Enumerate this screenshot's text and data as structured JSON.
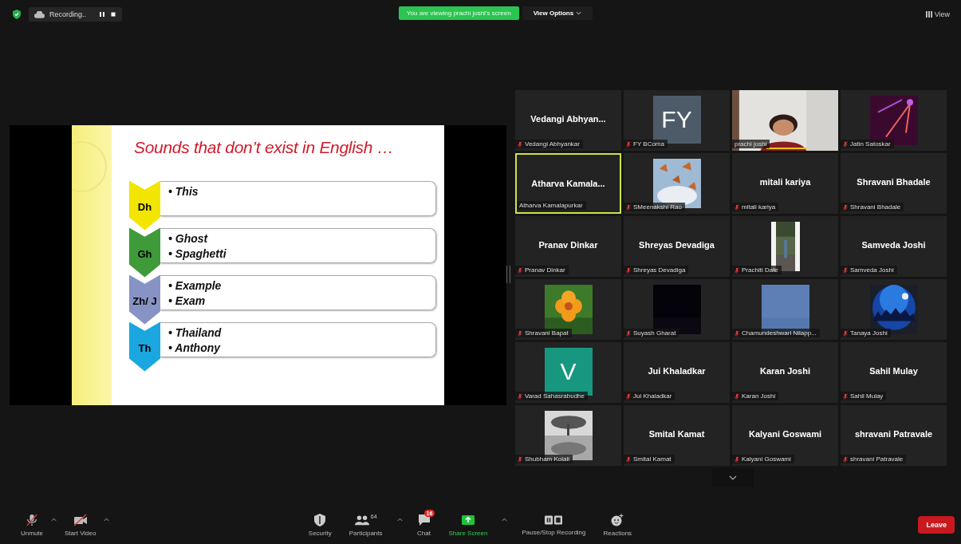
{
  "top_bar": {
    "recording": "Recording..",
    "banner": "You are viewing prachi joshi's screen",
    "view_options": "View Options",
    "view": "View"
  },
  "slide": {
    "title": "Sounds that don’t exist in English …",
    "items": [
      {
        "label": "Dh",
        "color": "#f2e600",
        "bullets": [
          "• This"
        ]
      },
      {
        "label": "Gh",
        "color": "#3f9a3a",
        "bullets": [
          "• Ghost",
          "• Spaghetti"
        ]
      },
      {
        "label": "Zh/ J",
        "color": "#8793c4",
        "bullets": [
          "• Example",
          "• Exam"
        ]
      },
      {
        "label": "Th",
        "color": "#1aa7e0",
        "bullets": [
          "• Thailand",
          "• Anthony"
        ]
      }
    ]
  },
  "tiles": [
    {
      "kind": "name",
      "display": "Vedangi  Abhyan...",
      "name": "Vedangi Abhyankar",
      "muted": true,
      "highlighted": false,
      "talking": false
    },
    {
      "kind": "initials",
      "display": "FY",
      "color": "#4d5b69",
      "name": "FY BComa",
      "muted": true,
      "highlighted": false,
      "talking": false
    },
    {
      "kind": "picture",
      "name": "prachi joshi",
      "muted": false,
      "highlighted": false,
      "talking": true
    },
    {
      "kind": "picture",
      "name": "Jatin Satoskar",
      "muted": true,
      "highlighted": false,
      "talking": false
    },
    {
      "kind": "name",
      "display": "Atharva  Kamala...",
      "name": "Atharva Kamalapurkar",
      "muted": false,
      "highlighted": true,
      "talking": false
    },
    {
      "kind": "picture",
      "name": "SMeenakshi Rao",
      "muted": true,
      "highlighted": false,
      "talking": false
    },
    {
      "kind": "name",
      "display": "mitali kariya",
      "name": "mitali kariya",
      "muted": true,
      "highlighted": false,
      "talking": false
    },
    {
      "kind": "name",
      "display": "Shravani Bhadale",
      "name": "Shravani Bhadale",
      "muted": true,
      "highlighted": false,
      "talking": false
    },
    {
      "kind": "name",
      "display": "Pranav Dinkar",
      "name": "Pranav Dinkar",
      "muted": true,
      "highlighted": false,
      "talking": false
    },
    {
      "kind": "name",
      "display": "Shreyas Devadiga",
      "name": "Shreyas Devadiga",
      "muted": true,
      "highlighted": false,
      "talking": false
    },
    {
      "kind": "picture",
      "name": "Prachiti Date",
      "muted": true,
      "highlighted": false,
      "talking": false
    },
    {
      "kind": "name",
      "display": "Samveda Joshi",
      "name": "Samveda Joshi",
      "muted": true,
      "highlighted": false,
      "talking": false
    },
    {
      "kind": "picture",
      "name": "Shravani Bapat",
      "muted": true,
      "highlighted": false,
      "talking": false
    },
    {
      "kind": "picture",
      "name": "Suyash Gharat",
      "muted": true,
      "highlighted": false,
      "talking": false
    },
    {
      "kind": "picture",
      "name": "Chamundeshwari Nilapp...",
      "muted": true,
      "highlighted": false,
      "talking": false
    },
    {
      "kind": "picture",
      "name": "Tanaya Joshi",
      "muted": true,
      "highlighted": false,
      "talking": false
    },
    {
      "kind": "initials",
      "display": "V",
      "color": "#17977f",
      "name": "Varad Sahasrabudhe",
      "muted": true,
      "highlighted": false,
      "talking": false
    },
    {
      "kind": "name",
      "display": "Jui Khaladkar",
      "name": "Jui Khaladkar",
      "muted": true,
      "highlighted": false,
      "talking": false
    },
    {
      "kind": "name",
      "display": "Karan Joshi",
      "name": "Karan Joshi",
      "muted": true,
      "highlighted": false,
      "talking": false
    },
    {
      "kind": "name",
      "display": "Sahil Mulay",
      "name": "Sahil Mulay",
      "muted": true,
      "highlighted": false,
      "talking": false
    },
    {
      "kind": "picture",
      "name": "Shubham Kolali",
      "muted": true,
      "highlighted": false,
      "talking": false
    },
    {
      "kind": "name",
      "display": "Smital Kamat",
      "name": "Smital Kamat",
      "muted": true,
      "highlighted": false,
      "talking": false
    },
    {
      "kind": "name",
      "display": "Kalyani Goswami",
      "name": "Kalyani Goswami",
      "muted": true,
      "highlighted": false,
      "talking": false
    },
    {
      "kind": "name",
      "display": "shravani Patravale",
      "name": "shravani Patravale",
      "muted": true,
      "highlighted": false,
      "talking": false
    }
  ],
  "toolbar": {
    "unmute": "Unmute",
    "start_video": "Start Video",
    "security": "Security",
    "participants": "Participants",
    "participant_count": "64",
    "chat": "Chat",
    "chat_badge": "16",
    "share_screen": "Share Screen",
    "recording": "Pause/Stop Recording",
    "reactions": "Reactions",
    "leave": "Leave"
  }
}
